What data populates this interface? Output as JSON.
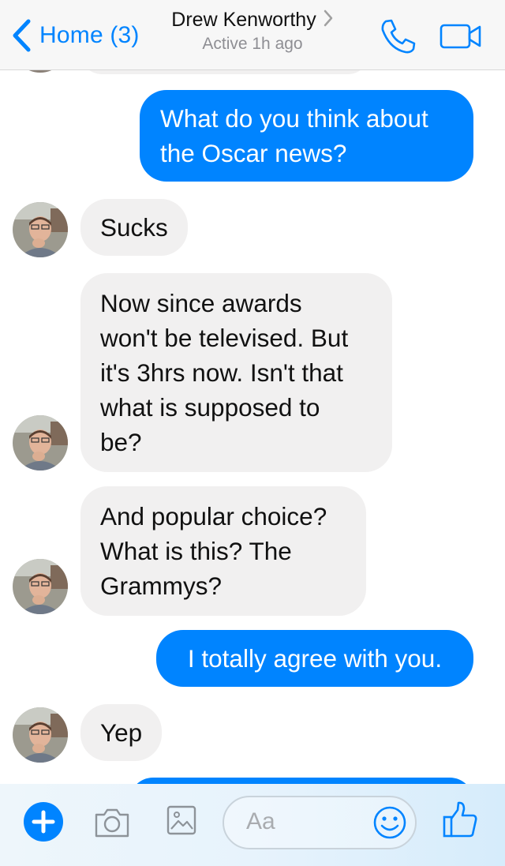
{
  "header": {
    "back_label": "Home (3)",
    "contact_name": "Drew Kenworthy",
    "contact_status": "Active 1h ago",
    "icons": {
      "back": "chevron-left-icon",
      "call": "phone-icon",
      "video": "video-camera-icon"
    }
  },
  "messages": [
    {
      "sender": "me",
      "text": "What do you think about\nthe Oscar news?"
    },
    {
      "sender": "Drew Kenworthy",
      "text": "Sucks"
    },
    {
      "sender": "Drew Kenworthy",
      "text": "Now since awards\nwon't be televised. But\nit's 3hrs now. Isn't that\nwhat is supposed to\nbe?"
    },
    {
      "sender": "Drew Kenworthy",
      "text": "And popular choice?\nWhat is this? The\nGrammys?"
    },
    {
      "sender": "me",
      "text": "I totally agree with you."
    },
    {
      "sender": "Drew Kenworthy",
      "text": "Yep"
    }
  ],
  "composer": {
    "placeholder": "Aa",
    "icons": {
      "add": "plus-icon",
      "camera": "camera-icon",
      "image": "image-icon",
      "emoji": "smiley-icon",
      "like": "thumbs-up-icon"
    }
  },
  "colors": {
    "accent": "#0084ff",
    "incoming_bubble": "#f1f0f0",
    "header_bg": "#f7f7f7",
    "muted_text": "#8e8e93"
  }
}
